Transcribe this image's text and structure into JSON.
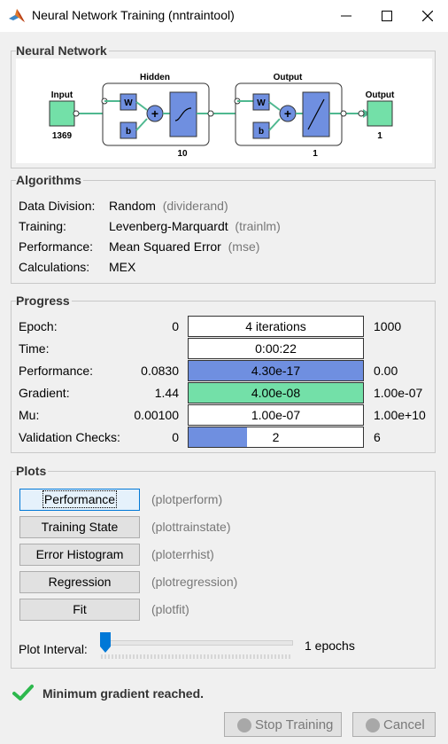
{
  "window": {
    "title": "Neural Network Training (nntraintool)"
  },
  "sections": {
    "network": "Neural Network",
    "algorithms": "Algorithms",
    "progress": "Progress",
    "plots": "Plots"
  },
  "diagram": {
    "input_label": "Input",
    "input_size": "1369",
    "hidden_label": "Hidden",
    "hidden_size": "10",
    "output_layer_label": "Output",
    "output_layer_size": "1",
    "output_label": "Output",
    "output_size": "1",
    "weight_symbol": "W",
    "bias_symbol": "b"
  },
  "algorithms": [
    {
      "label": "Data Division:",
      "value": "Random",
      "func": "(dividerand)"
    },
    {
      "label": "Training:",
      "value": "Levenberg-Marquardt",
      "func": "(trainlm)"
    },
    {
      "label": "Performance:",
      "value": "Mean Squared Error",
      "func": "(mse)"
    },
    {
      "label": "Calculations:",
      "value": "MEX",
      "func": ""
    }
  ],
  "progress": [
    {
      "label": "Epoch:",
      "min": "0",
      "text": "4 iterations",
      "max": "1000",
      "fill": 0,
      "color": "#ffffff"
    },
    {
      "label": "Time:",
      "min": "",
      "text": "0:00:22",
      "max": "",
      "fill": 0,
      "color": "#ffffff"
    },
    {
      "label": "Performance:",
      "min": "0.0830",
      "text": "4.30e-17",
      "max": "0.00",
      "fill": 1,
      "color": "#6f8fe0"
    },
    {
      "label": "Gradient:",
      "min": "1.44",
      "text": "4.00e-08",
      "max": "1.00e-07",
      "fill": 1,
      "color": "#73e0a8"
    },
    {
      "label": "Mu:",
      "min": "0.00100",
      "text": "1.00e-07",
      "max": "1.00e+10",
      "fill": 0,
      "color": "#ffffff"
    },
    {
      "label": "Validation Checks:",
      "min": "0",
      "text": "2",
      "max": "6",
      "fill": 0.333,
      "color": "#6f8fe0"
    }
  ],
  "plots": [
    {
      "label": "Performance",
      "func": "(plotperform)",
      "focused": true
    },
    {
      "label": "Training State",
      "func": "(plottrainstate)",
      "focused": false
    },
    {
      "label": "Error Histogram",
      "func": "(ploterrhist)",
      "focused": false
    },
    {
      "label": "Regression",
      "func": "(plotregression)",
      "focused": false
    },
    {
      "label": "Fit",
      "func": "(plotfit)",
      "focused": false
    }
  ],
  "plot_interval": {
    "label": "Plot Interval:",
    "value_text": "1 epochs",
    "value": 1
  },
  "status": {
    "text": "Minimum gradient reached.",
    "icon": "check-icon",
    "color": "#2db84d"
  },
  "footer": {
    "stop_label": "Stop Training",
    "cancel_label": "Cancel"
  },
  "colors": {
    "layer_fill": "#6f8fe0",
    "io_fill": "#73e0a8",
    "connector": "#4fb890"
  }
}
